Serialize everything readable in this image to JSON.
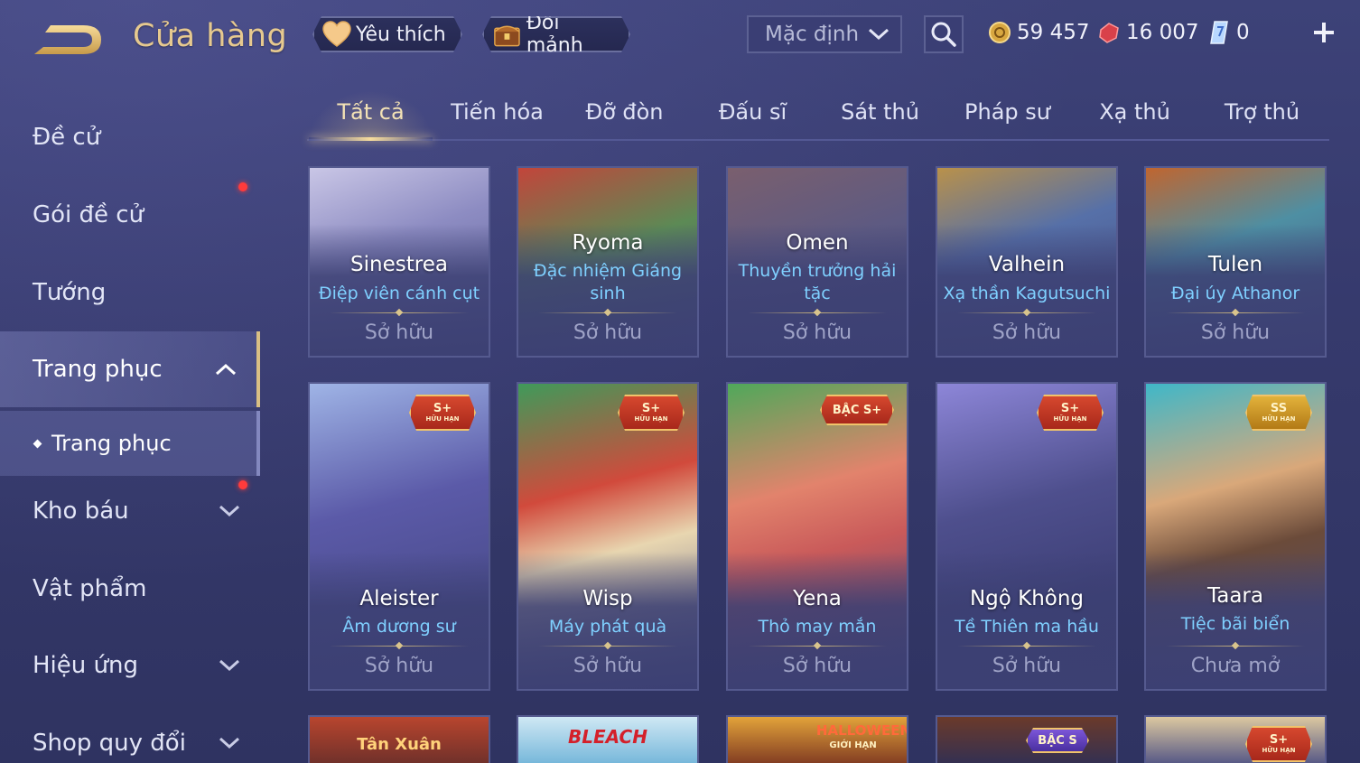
{
  "header": {
    "title": "Cửa hàng",
    "favorite_label": "Yêu thích",
    "fragment_label": "Đổi mảnh",
    "sort_value": "Mặc định",
    "currencies": {
      "gold": "59 457",
      "ruby": "16 007",
      "crystal": "0"
    }
  },
  "sidebar": {
    "items": [
      {
        "label": "Đề cử"
      },
      {
        "label": "Gói đề cử"
      },
      {
        "label": "Tướng"
      },
      {
        "label": "Trang phục"
      },
      {
        "label": "Kho báu"
      },
      {
        "label": "Vật phẩm"
      },
      {
        "label": "Hiệu ứng"
      },
      {
        "label": "Shop quy đổi"
      }
    ],
    "sub_item": "Trang phục"
  },
  "tabs": [
    {
      "label": "Tất cả"
    },
    {
      "label": "Tiến hóa"
    },
    {
      "label": "Đỡ đòn"
    },
    {
      "label": "Đấu sĩ"
    },
    {
      "label": "Sát thủ"
    },
    {
      "label": "Pháp sư"
    },
    {
      "label": "Xạ thủ"
    },
    {
      "label": "Trợ thủ"
    }
  ],
  "cards_row1": [
    {
      "hero": "Sinestrea",
      "skin": "Điệp viên cánh cụt",
      "status": "Sở hữu"
    },
    {
      "hero": "Ryoma",
      "skin": "Đặc nhiệm Giáng sinh",
      "status": "Sở hữu"
    },
    {
      "hero": "Omen",
      "skin": "Thuyền trưởng hải tặc",
      "status": "Sở hữu"
    },
    {
      "hero": "Valhein",
      "skin": "Xạ thần Kagutsuchi",
      "status": "Sở hữu"
    },
    {
      "hero": "Tulen",
      "skin": "Đại úy Athanor",
      "status": "Sở hữu"
    }
  ],
  "cards_row2": [
    {
      "hero": "Aleister",
      "skin": "Âm dương sư",
      "status": "Sở hữu",
      "badge": "S+",
      "badge_sub": "HỮU HẠN"
    },
    {
      "hero": "Wisp",
      "skin": "Máy phát quà",
      "status": "Sở hữu",
      "badge": "S+",
      "badge_sub": "HỮU HẠN"
    },
    {
      "hero": "Yena",
      "skin": "Thỏ may mắn",
      "status": "Sở hữu",
      "badge": "BẬC S+"
    },
    {
      "hero": "Ngộ Không",
      "skin": "Tề Thiên ma hầu",
      "status": "Sở hữu",
      "badge": "S+",
      "badge_sub": "HỮU HẠN"
    },
    {
      "hero": "Taara",
      "skin": "Tiệc bãi biển",
      "status": "Chưa mở",
      "badge": "SS",
      "badge_sub": "HỮU HẠN"
    }
  ],
  "cards_row3": [
    {
      "banner": "Tân Xuân"
    },
    {
      "banner": "BLEACH"
    },
    {
      "banner": "HALLOWEEN",
      "banner_sub": "GIỚI HẠN"
    },
    {
      "banner": "BẬC S"
    },
    {
      "banner": "S+",
      "banner_sub": "HỮU HẠN"
    }
  ],
  "colors": {
    "background": "#363a6d",
    "accent_gold": "#e6c98f",
    "skin_name_blue": "#7fd0ff",
    "notification_red": "#ff3b3b"
  }
}
